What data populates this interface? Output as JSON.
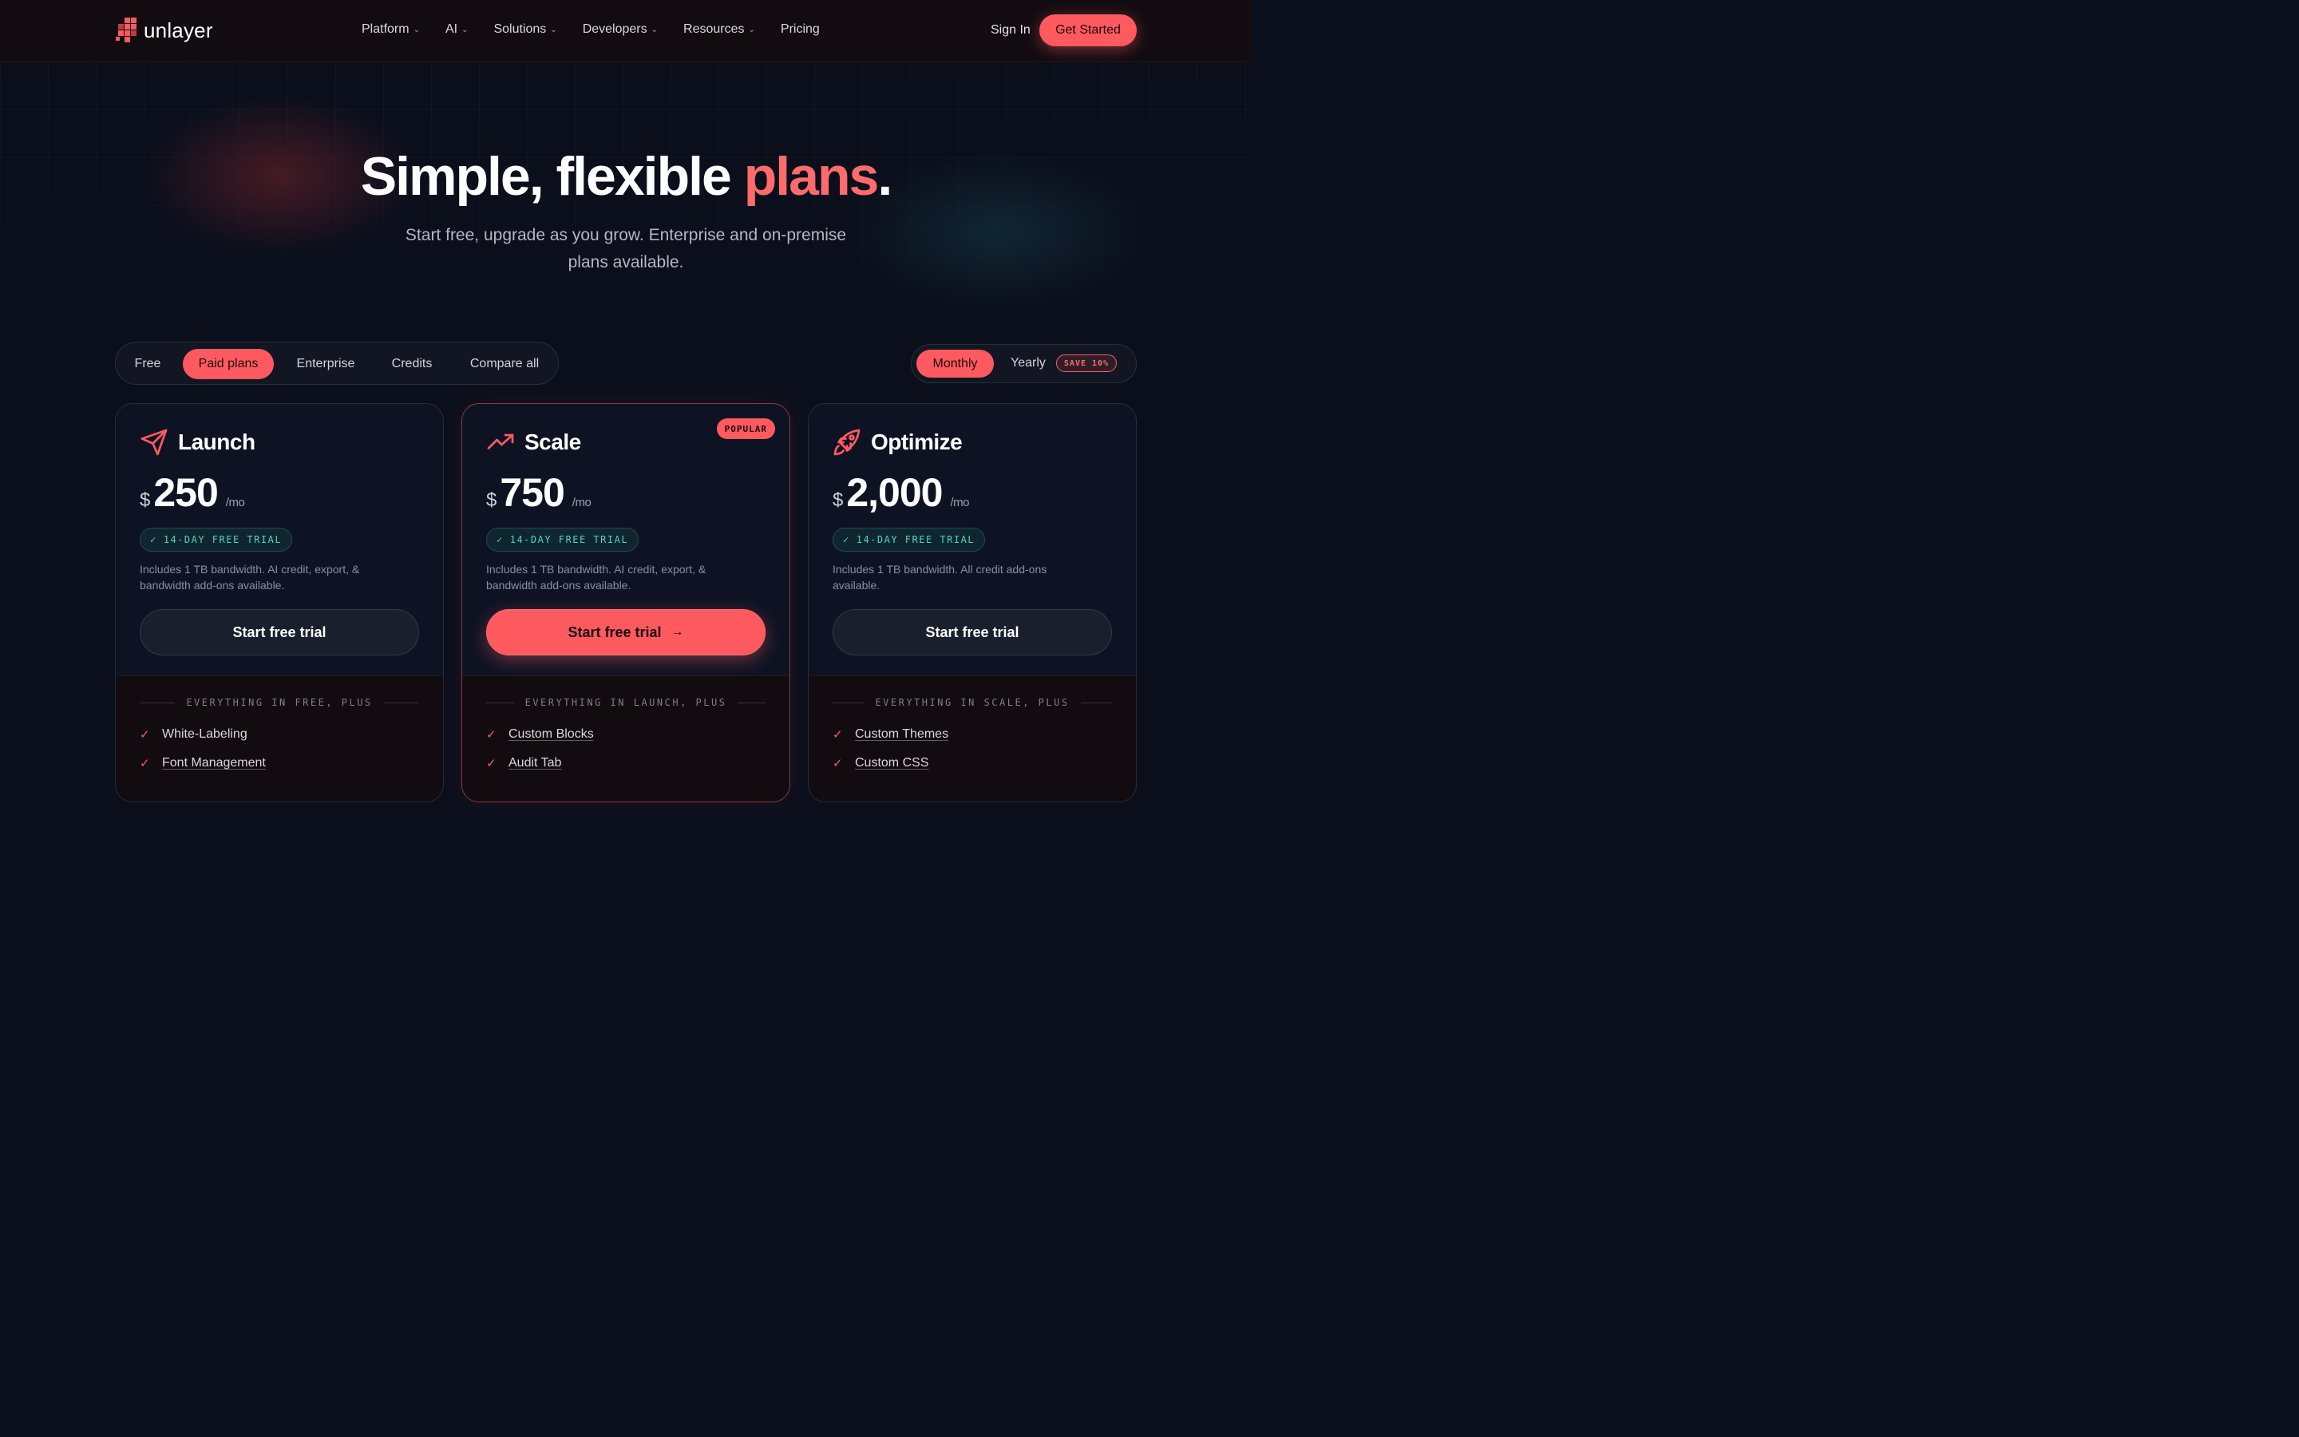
{
  "nav": {
    "logo_text": "unlayer",
    "menu": [
      {
        "label": "Platform",
        "dropdown": true
      },
      {
        "label": "AI",
        "dropdown": true
      },
      {
        "label": "Solutions",
        "dropdown": true
      },
      {
        "label": "Developers",
        "dropdown": true
      },
      {
        "label": "Resources",
        "dropdown": true
      },
      {
        "label": "Pricing",
        "dropdown": false
      }
    ],
    "sign_in": "Sign In",
    "get_started": "Get Started"
  },
  "hero": {
    "title_main": "Simple, flexible ",
    "title_accent": "plans",
    "title_end": ".",
    "subtitle": "Start free, upgrade as you grow. Enterprise and on-premise plans available."
  },
  "tabs": {
    "items": [
      "Free",
      "Paid plans",
      "Enterprise",
      "Credits",
      "Compare all"
    ],
    "active": "Paid plans"
  },
  "billing": {
    "monthly": "Monthly",
    "yearly": "Yearly",
    "save_badge": "SAVE 10%",
    "selected": "Monthly"
  },
  "colors": {
    "accent": "#ff5a5f",
    "background": "#0b0f1c",
    "teal": "#4fd1c5"
  },
  "plans": [
    {
      "name": "Launch",
      "icon": "paper-plane-icon",
      "currency": "$",
      "price": "250",
      "period": "/mo",
      "trial": "14-DAY FREE TRIAL",
      "description": "Includes 1 TB bandwidth. AI credit, export, & bandwidth add-ons available.",
      "cta": "Start free trial",
      "features_heading": "EVERYTHING IN FREE, PLUS",
      "features": [
        "White-Labeling",
        "Font Management"
      ]
    },
    {
      "name": "Scale",
      "icon": "trending-up-icon",
      "badge": "POPULAR",
      "currency": "$",
      "price": "750",
      "period": "/mo",
      "trial": "14-DAY FREE TRIAL",
      "description": "Includes 1 TB bandwidth. AI credit, export, & bandwidth add-ons available.",
      "cta": "Start free trial",
      "cta_arrow": "→",
      "features_heading": "EVERYTHING IN LAUNCH, PLUS",
      "features": [
        "Custom Blocks",
        "Audit Tab"
      ]
    },
    {
      "name": "Optimize",
      "icon": "rocket-icon",
      "currency": "$",
      "price": "2,000",
      "period": "/mo",
      "trial": "14-DAY FREE TRIAL",
      "description": "Includes 1 TB bandwidth. All credit add-ons available.",
      "cta": "Start free trial",
      "features_heading": "EVERYTHING IN SCALE, PLUS",
      "features": [
        "Custom Themes",
        "Custom CSS"
      ]
    }
  ]
}
